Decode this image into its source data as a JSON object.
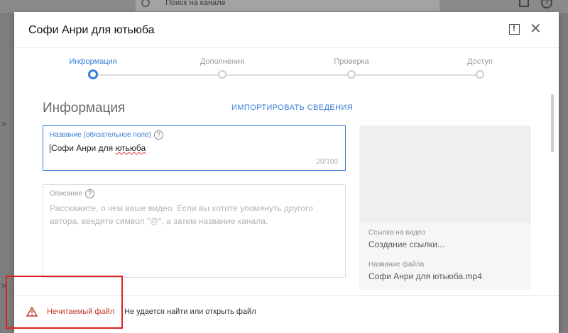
{
  "background": {
    "search_placeholder": "Поиск на канале"
  },
  "modal": {
    "title": "Софи Анри для ютьюба",
    "close_glyph": "✕"
  },
  "stepper": {
    "steps": [
      {
        "label": "Информация",
        "active": true
      },
      {
        "label": "Дополнения",
        "active": false
      },
      {
        "label": "Проверка",
        "active": false
      },
      {
        "label": "Доступ",
        "active": false
      }
    ]
  },
  "content": {
    "section_title": "Информация",
    "import_link": "ИМПОРТИРОВАТЬ СВЕДЕНИЯ",
    "title_field": {
      "label": "Название (обязательное поле)",
      "value_prefix": "Софи Анри для ",
      "value_misspelled": "ютьюба",
      "counter": "20/100"
    },
    "description_field": {
      "label": "Описание",
      "placeholder": "Расскажите, о чем ваше видео. Если вы хотите упомянуть другого автора, введите символ \"@\", а затем название канала."
    },
    "video_link_label": "Ссылка на видео",
    "video_link_value": "Создание ссылки...",
    "file_name_label": "Название файла",
    "file_name_value": "Софи Анри для ютьюба.mp4"
  },
  "footer": {
    "warning_label": "Нечитаемый файл",
    "warning_message": "Не удается найти или открыть файл"
  },
  "colors": {
    "accent": "#3b7ed8",
    "error": "#c0392b",
    "highlight": "#e02020"
  }
}
